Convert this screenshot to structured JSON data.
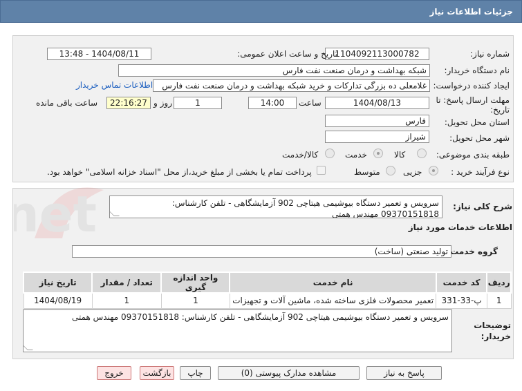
{
  "header": {
    "title": "جزئیات اطلاعات نیاز"
  },
  "form": {
    "need_number": {
      "label": "شماره نیاز:",
      "value": "1104092113000782"
    },
    "announce_datetime": {
      "label": "تاریخ و ساعت اعلان عمومی:",
      "value": "1404/08/11 - 13:48"
    },
    "buyer_org": {
      "label": "نام دستگاه خریدار:",
      "value": "شبکه بهداشت و درمان صنعت نفت فارس"
    },
    "requester": {
      "label": "ایجاد کننده درخواست:",
      "value": "غلامعلی ده بزرگی تدارکات و خرید شبکه بهداشت و درمان صنعت نفت فارس",
      "contact_link": "اطلاعات تماس خریدار"
    },
    "deadline": {
      "label": "مهلت ارسال پاسخ: تا تاریخ:",
      "date": "1404/08/13",
      "time_label": "ساعت",
      "time": "14:00",
      "days": "1",
      "days_label": "روز و",
      "remaining": "22:16:27",
      "remaining_label": "ساعت باقی مانده"
    },
    "province": {
      "label": "استان محل تحویل:",
      "value": "فارس"
    },
    "city": {
      "label": "شهر محل تحویل:",
      "value": "شیراز"
    },
    "category": {
      "label": "طبقه بندی موضوعی:",
      "options": [
        "کالا",
        "خدمت",
        "کالا/خدمت"
      ],
      "selected": "خدمت"
    },
    "process_type": {
      "label": "نوع فرآیند خرید :",
      "options": [
        "جزیی",
        "متوسط"
      ],
      "selected": "جزیی",
      "payment_note": "پرداخت تمام یا بخشی از مبلغ خرید،از محل \"اسناد خزانه اسلامی\" خواهد بود."
    }
  },
  "general_description": {
    "label": "شرح کلی نیاز:",
    "value": "سرویس و تعمیر دستگاه بیوشیمی هیتاچی 902 آزمایشگاهی - تلفن کارشناس: 09370151818 مهندس همتی"
  },
  "services_section": {
    "title": "اطلاعات خدمات مورد نیاز",
    "service_group_label": "گروه خدمت:",
    "service_group_value": "تولید صنعتی (ساخت)"
  },
  "table": {
    "headers": [
      "ردیف",
      "کد خدمت",
      "نام خدمت",
      "واحد اندازه گیری",
      "تعداد / مقدار",
      "تاریخ نیاز"
    ],
    "rows": [
      [
        "1",
        "پ-33-331",
        "تعمیر محصولات فلزی ساخته شده، ماشین آلات و تجهیزات",
        "1",
        "1",
        "1404/08/19"
      ]
    ]
  },
  "buyer_notes": {
    "label": "توضیحات خریدار:",
    "value": "سرویس و تعمیر دستگاه بیوشیمی هیتاچی 902 آزمایشگاهی - تلفن کارشناس: 09370151818 مهندس همتی"
  },
  "buttons": {
    "reply": "پاسخ به نیاز",
    "attachments": "مشاهده مدارک پیوستی (0)",
    "print": "چاپ",
    "back": "بازگشت",
    "exit": "خروج"
  },
  "watermark_text": "AriaTender.net",
  "colors": {
    "header_bg": "#5f82a8",
    "link": "#1a5dbf",
    "remaining_bg": "#ffffcc"
  }
}
